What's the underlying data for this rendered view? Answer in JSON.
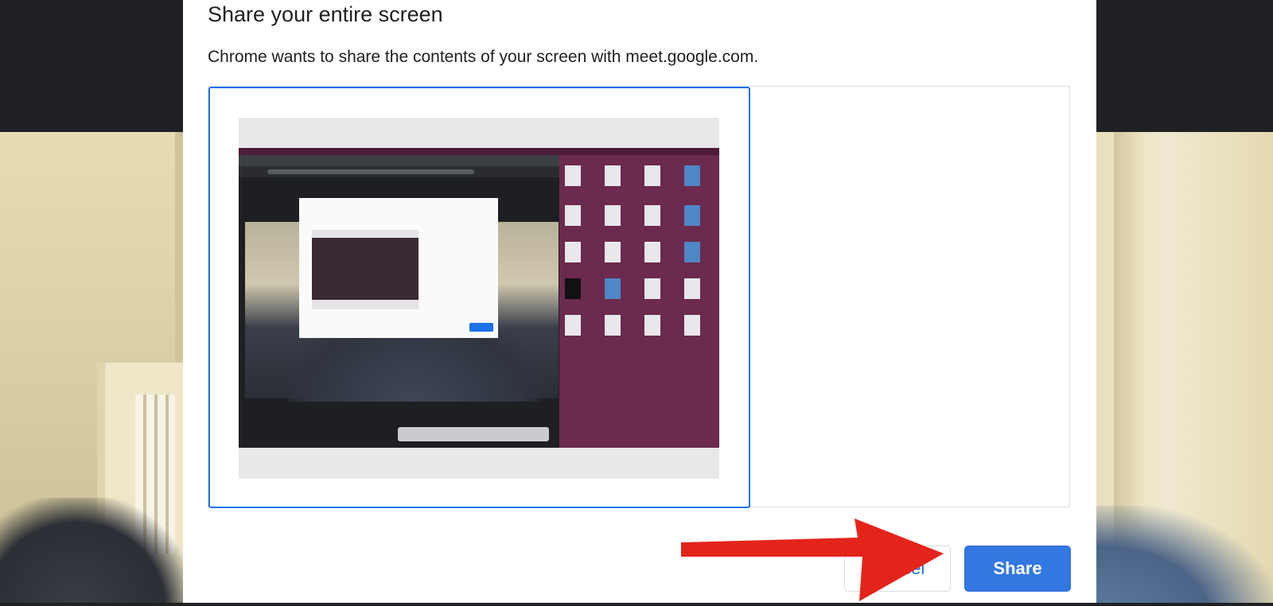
{
  "dialog": {
    "title": "Share your entire screen",
    "subtitle": "Chrome wants to share the contents of your screen with meet.google.com."
  },
  "buttons": {
    "cancel_label": "Cancel",
    "share_label": "Share"
  },
  "colors": {
    "accent": "#1a73e8",
    "share_button": "#3377e0",
    "annotation_arrow": "#e3241b",
    "desktop_wallpaper": "#6b2a4e"
  },
  "icons": {
    "annotation": "red-arrow-icon"
  }
}
